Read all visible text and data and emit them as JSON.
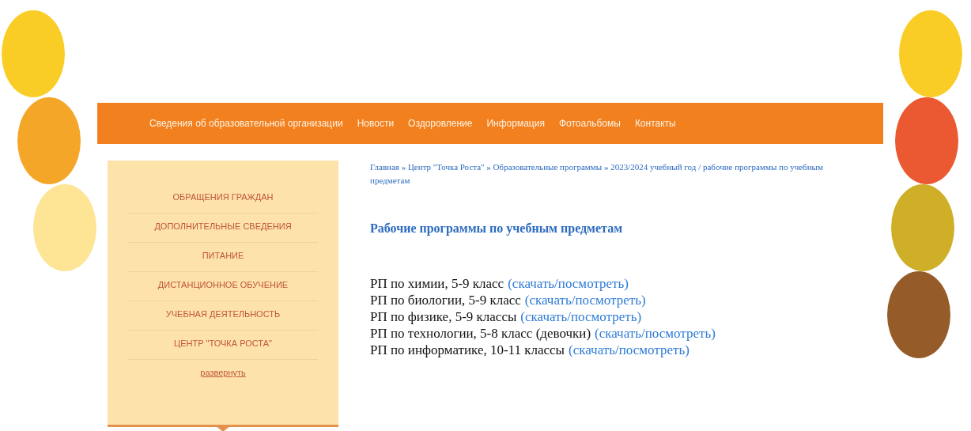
{
  "nav": {
    "items": [
      {
        "label": "Сведения об образовательной организации"
      },
      {
        "label": "Новости"
      },
      {
        "label": "Оздоровление"
      },
      {
        "label": "Информация"
      },
      {
        "label": "Фотоальбомы"
      },
      {
        "label": "Контакты"
      }
    ]
  },
  "sidebar": {
    "items": [
      {
        "label": "ОБРАЩЕНИЯ ГРАЖДАН"
      },
      {
        "label": "ДОПОЛНИТЕЛЬНЫЕ СВЕДЕНИЯ"
      },
      {
        "label": "ПИТАНИЕ"
      },
      {
        "label": "ДИСТАНЦИОННОЕ ОБУЧЕНИЕ"
      },
      {
        "label": "УЧЕБНАЯ ДЕЯТЕЛЬНОСТЬ"
      },
      {
        "label": "ЦЕНТР \"ТОЧКА РОСТА\""
      }
    ],
    "expand_link": "развернуть"
  },
  "breadcrumb": "Главная » Центр \"Точка Роста\" » Образовательные программы » 2023/2024 учебный год / рабочие программы по учебным предметам",
  "heading": "Рабочие программы по учебным предметам",
  "programs": [
    {
      "text": "РП по химии, 5-9 класс",
      "link": "(скачать/посмотреть)"
    },
    {
      "text": "РП по биологии, 5-9 класс",
      "link": "(скачать/посмотреть)"
    },
    {
      "text": "РП по физике, 5-9 классы",
      "link": "(скачать/посмотреть)"
    },
    {
      "text": "РП по технологии, 5-8 класс (девочки)",
      "link": "(скачать/посмотреть)"
    },
    {
      "text": "РП по информатике, 10-11 классы",
      "link": "(скачать/посмотреть)"
    }
  ]
}
